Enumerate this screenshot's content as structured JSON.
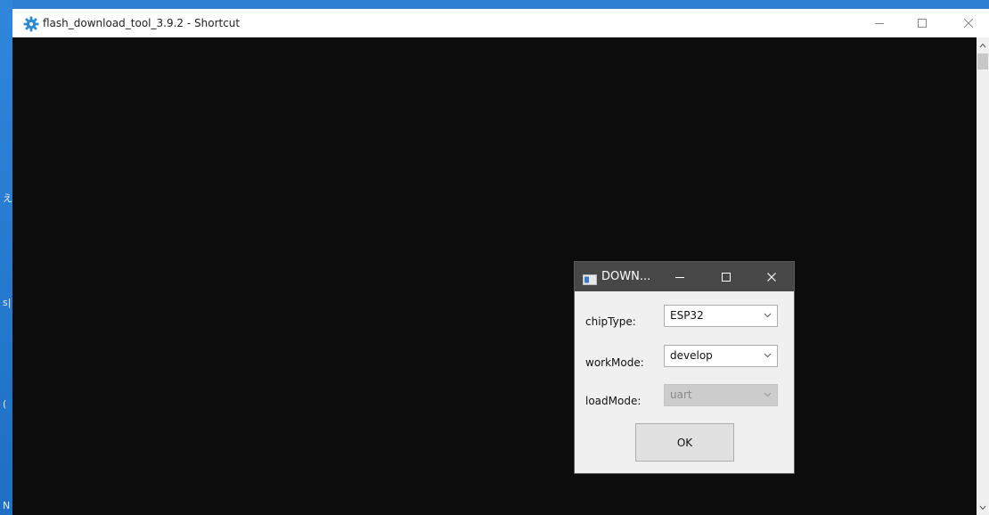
{
  "desktop": {
    "glyphs": [
      "え",
      "s|",
      "(",
      "N"
    ]
  },
  "console_window": {
    "title": "flash_download_tool_3.9.2 - Shortcut",
    "icon": "gear-icon",
    "background": "#0c0c0c"
  },
  "dialog": {
    "title": "DOWN...",
    "fields": [
      {
        "label": "chipType:",
        "value": "ESP32",
        "enabled": true
      },
      {
        "label": "workMode:",
        "value": "develop",
        "enabled": true
      },
      {
        "label": "loadMode:",
        "value": "uart",
        "enabled": false
      }
    ],
    "ok_label": "OK"
  },
  "colors": {
    "dialog_titlebar": "#474747",
    "gear_icon": "#2a8ad6"
  }
}
